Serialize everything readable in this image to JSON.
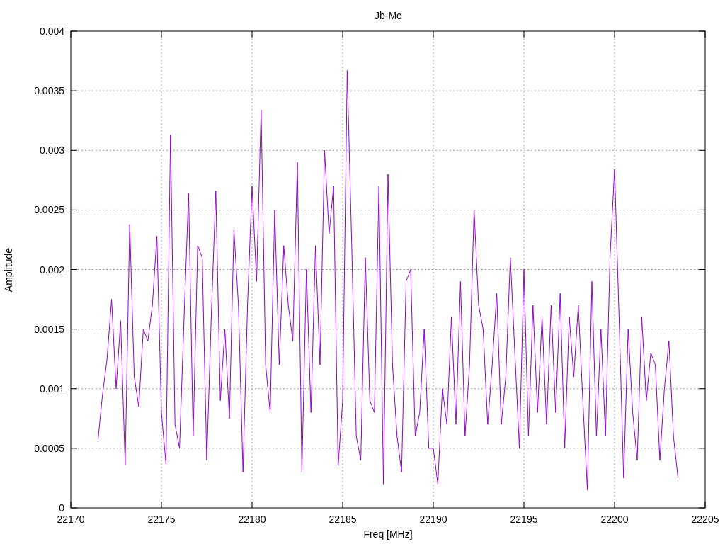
{
  "chart_data": {
    "type": "line",
    "grid": true,
    "title": "Jb-Mc",
    "xlabel": "Freq [MHz]",
    "ylabel": "Amplitude",
    "xlim": [
      22170,
      22205
    ],
    "ylim": [
      0,
      0.004
    ],
    "xticks": [
      22170,
      22175,
      22180,
      22185,
      22190,
      22195,
      22200,
      22205
    ],
    "yticks": [
      0,
      0.0005,
      0.001,
      0.0015,
      0.002,
      0.0025,
      0.003,
      0.0035,
      0.004
    ],
    "x": [
      22171.5,
      22171.75,
      22172,
      22172.25,
      22172.5,
      22172.75,
      22173,
      22173.25,
      22173.5,
      22173.75,
      22174,
      22174.25,
      22174.5,
      22174.75,
      22175,
      22175.25,
      22175.5,
      22175.75,
      22176,
      22176.25,
      22176.5,
      22176.75,
      22177,
      22177.25,
      22177.5,
      22177.75,
      22178,
      22178.25,
      22178.5,
      22178.75,
      22179,
      22179.25,
      22179.5,
      22179.75,
      22180,
      22180.25,
      22180.5,
      22180.75,
      22181,
      22181.25,
      22181.5,
      22181.75,
      22182,
      22182.25,
      22182.5,
      22182.75,
      22183,
      22183.25,
      22183.5,
      22183.75,
      22184,
      22184.25,
      22184.5,
      22184.75,
      22185,
      22185.25,
      22185.5,
      22185.75,
      22186,
      22186.25,
      22186.5,
      22186.75,
      22187,
      22187.25,
      22187.5,
      22187.75,
      22188,
      22188.25,
      22188.5,
      22188.75,
      22189,
      22189.25,
      22189.5,
      22189.75,
      22190,
      22190.25,
      22190.5,
      22190.75,
      22191,
      22191.25,
      22191.5,
      22191.75,
      22192,
      22192.25,
      22192.5,
      22192.75,
      22193,
      22193.25,
      22193.5,
      22193.75,
      22194,
      22194.25,
      22194.5,
      22194.75,
      22195,
      22195.25,
      22195.5,
      22195.75,
      22196,
      22196.25,
      22196.5,
      22196.75,
      22197,
      22197.25,
      22197.5,
      22197.75,
      22198,
      22198.25,
      22198.5,
      22198.75,
      22199,
      22199.25,
      22199.5,
      22199.75,
      22200,
      22200.25,
      22200.5,
      22200.75,
      22201,
      22201.25,
      22201.5,
      22201.75,
      22202,
      22202.25,
      22202.5,
      22202.75,
      22203,
      22203.25,
      22203.5
    ],
    "series": [
      {
        "color": "#9400d3",
        "values": [
          0.00057,
          0.00095,
          0.00125,
          0.00175,
          0.001,
          0.00157,
          0.00036,
          0.00238,
          0.0011,
          0.00085,
          0.0015,
          0.0014,
          0.0017,
          0.00228,
          0.0008,
          0.00037,
          0.00313,
          0.0007,
          0.0005,
          0.0016,
          0.00264,
          0.0006,
          0.0022,
          0.0021,
          0.0004,
          0.0016,
          0.00266,
          0.0009,
          0.0015,
          0.00075,
          0.00233,
          0.0017,
          0.0003,
          0.0017,
          0.0027,
          0.0019,
          0.00334,
          0.0012,
          0.0008,
          0.0025,
          0.0012,
          0.0022,
          0.0017,
          0.0014,
          0.0029,
          0.0003,
          0.002,
          0.0008,
          0.0022,
          0.0012,
          0.003,
          0.0023,
          0.0027,
          0.00035,
          0.0009,
          0.00367,
          0.0022,
          0.0006,
          0.0004,
          0.0021,
          0.0009,
          0.0008,
          0.0027,
          0.0002,
          0.0028,
          0.0012,
          0.0006,
          0.0003,
          0.0019,
          0.002,
          0.0006,
          0.0008,
          0.0015,
          0.0005,
          0.0005,
          0.0002,
          0.001,
          0.0007,
          0.0016,
          0.0007,
          0.0019,
          0.0006,
          0.0012,
          0.0025,
          0.0017,
          0.0015,
          0.0007,
          0.0012,
          0.0018,
          0.0007,
          0.0011,
          0.0021,
          0.0013,
          0.0005,
          0.002,
          0.0006,
          0.0017,
          0.0008,
          0.0016,
          0.0007,
          0.0017,
          0.0008,
          0.0018,
          0.0005,
          0.0016,
          0.0011,
          0.0017,
          0.0009,
          0.00015,
          0.0019,
          0.0006,
          0.0015,
          0.0006,
          0.0021,
          0.00284,
          0.0016,
          0.00025,
          0.0015,
          0.0008,
          0.0004,
          0.0016,
          0.0009,
          0.0013,
          0.0012,
          0.0004,
          0.001,
          0.0014,
          0.0006,
          0.00025
        ]
      }
    ]
  }
}
